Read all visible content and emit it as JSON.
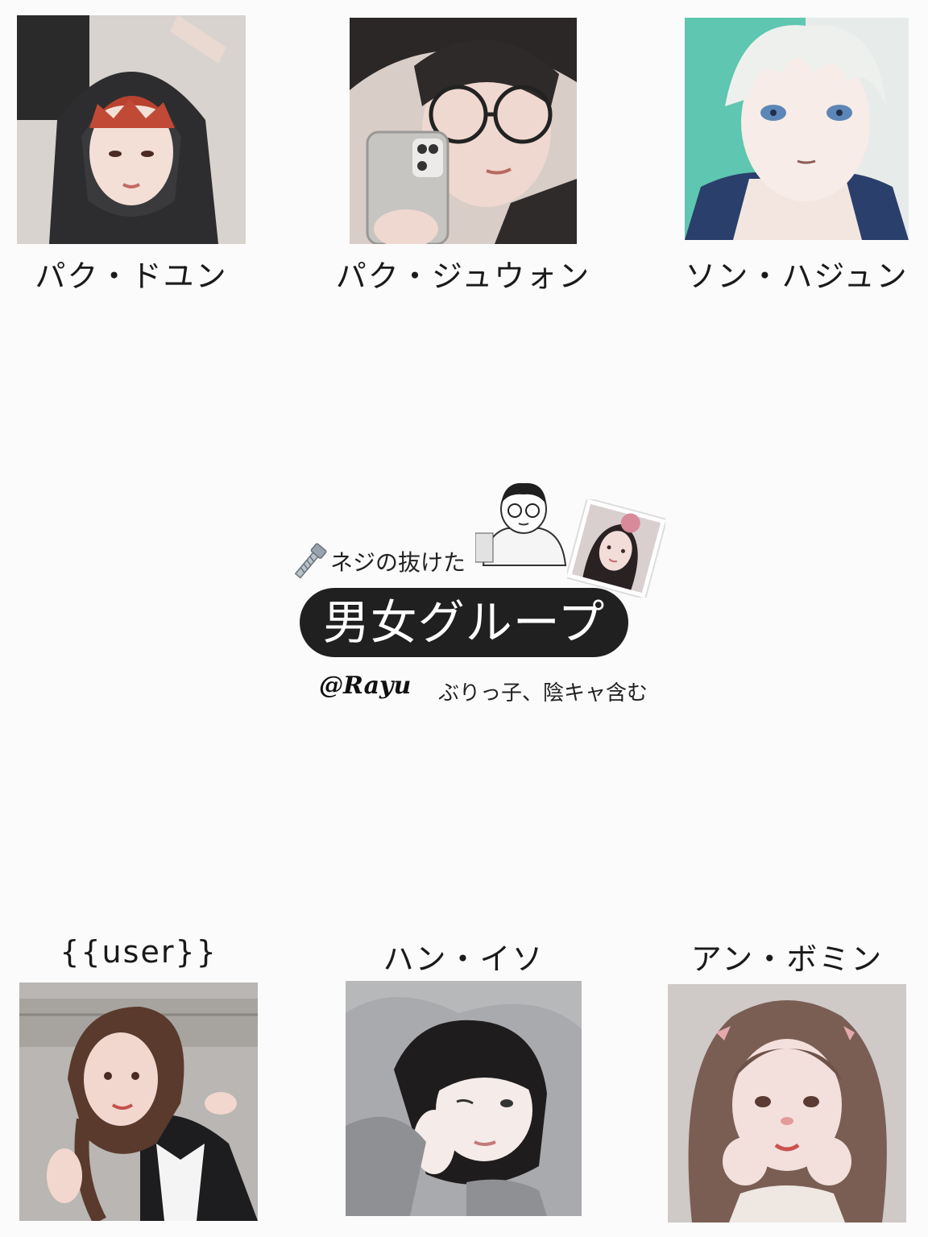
{
  "characters_top": [
    {
      "name": "パク・ドユン",
      "portrait": "red-haired-boy-in-black-hoodie"
    },
    {
      "name": "パク・ジュウォン",
      "portrait": "boy-with-glasses-taking-mirror-selfie"
    },
    {
      "name": "ソン・ハジュン",
      "portrait": "white-haired-blue-eyed-boy"
    }
  ],
  "center": {
    "tagline": "ネジの抜けた",
    "title": "男女グループ",
    "handle": "@Rayu",
    "note": "ぶりっ子、陰キャ含む",
    "icons": [
      "bolt-icon"
    ],
    "stickers": [
      "boy-with-glasses-sticker",
      "girl-portrait-sticker"
    ]
  },
  "characters_bottom": [
    {
      "name": "{{user}}",
      "portrait": "girl-with-braids-waving"
    },
    {
      "name": "ハン・イソ",
      "portrait": "dark-haired-girl-in-grey-hoodie-winking"
    },
    {
      "name": "アン・ボミン",
      "portrait": "brown-haired-girl-with-ribbons"
    }
  ],
  "colors": {
    "background": "#fbfbfb",
    "pill": "#202020",
    "text": "#1c1c1c"
  }
}
